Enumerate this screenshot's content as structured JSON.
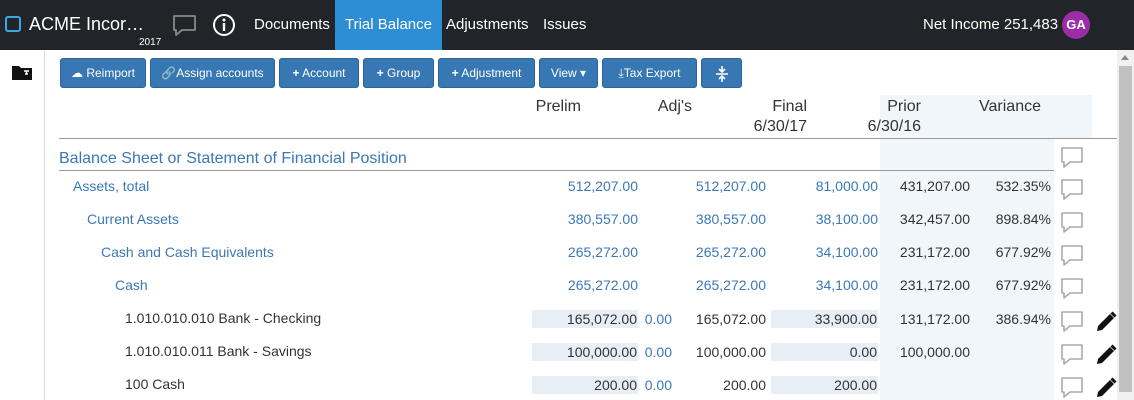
{
  "header": {
    "app_title": "ACME Incor…",
    "year": "2017",
    "nav": [
      "Documents",
      "Trial Balance",
      "Adjustments",
      "Issues"
    ],
    "active_nav": "Trial Balance",
    "net_income_label": "Net Income 251,483",
    "avatar_initials": "GA"
  },
  "toolbar": {
    "reimport": "Reimport",
    "assign_accounts": "Assign accounts",
    "account": "Account",
    "group": "Group",
    "adjustment": "Adjustment",
    "view": "View",
    "tax_export": "Tax Export"
  },
  "columns": {
    "prelim": "Prelim",
    "adjs": "Adj's",
    "final": "Final",
    "final_date": "6/30/17",
    "prior": "Prior",
    "prior_date": "6/30/16",
    "variance": "Variance"
  },
  "section_title": "Balance Sheet or Statement of Financial Position",
  "rows": [
    {
      "label": "Assets, total",
      "prelim": "512,207.00",
      "adj": "",
      "final": "512,207.00",
      "prior": "81,000.00",
      "variance": "431,207.00",
      "pct": "532.35%"
    },
    {
      "label": "Current Assets",
      "prelim": "380,557.00",
      "adj": "",
      "final": "380,557.00",
      "prior": "38,100.00",
      "variance": "342,457.00",
      "pct": "898.84%"
    },
    {
      "label": "Cash and Cash Equivalents",
      "prelim": "265,272.00",
      "adj": "",
      "final": "265,272.00",
      "prior": "34,100.00",
      "variance": "231,172.00",
      "pct": "677.92%"
    },
    {
      "label": "Cash",
      "prelim": "265,272.00",
      "adj": "",
      "final": "265,272.00",
      "prior": "34,100.00",
      "variance": "231,172.00",
      "pct": "677.92%"
    },
    {
      "label": "1.010.010.010 Bank - Checking",
      "prelim": "165,072.00",
      "adj": "0.00",
      "final": "165,072.00",
      "prior": "33,900.00",
      "variance": "131,172.00",
      "pct": "386.94%"
    },
    {
      "label": "1.010.010.011 Bank - Savings",
      "prelim": "100,000.00",
      "adj": "0.00",
      "final": "100,000.00",
      "prior": "0.00",
      "variance": "100,000.00",
      "pct": ""
    },
    {
      "label": "100 Cash",
      "prelim": "200.00",
      "adj": "0.00",
      "final": "200.00",
      "prior": "200.00",
      "variance": "",
      "pct": ""
    }
  ]
}
